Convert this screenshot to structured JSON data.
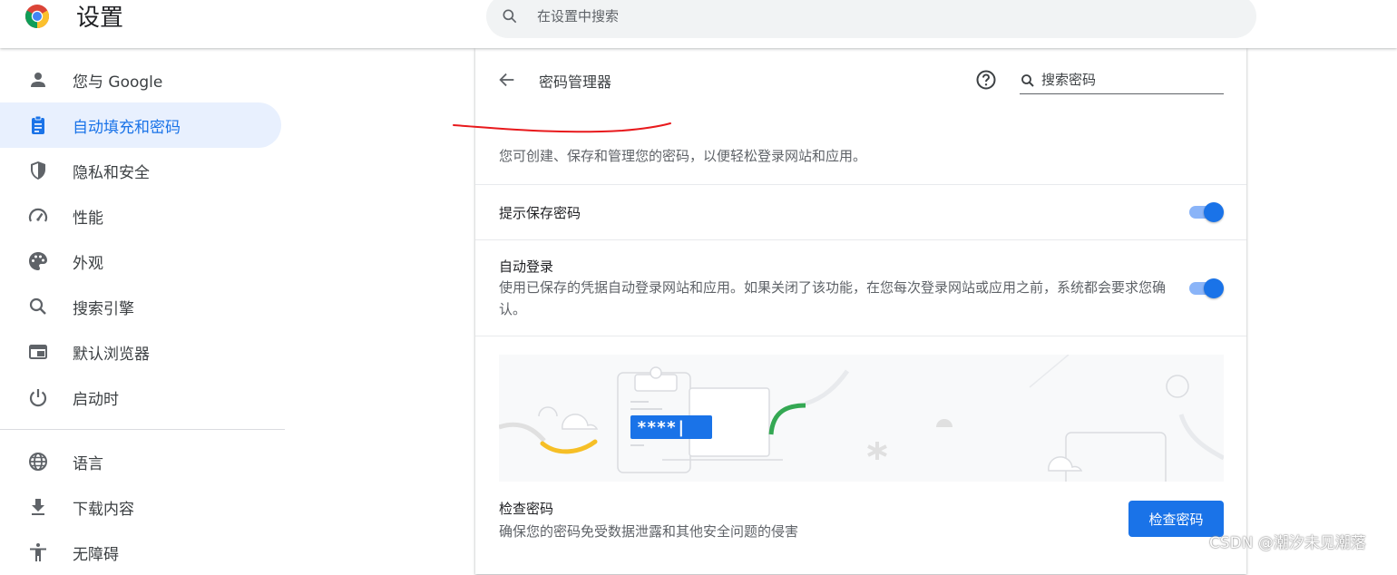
{
  "header": {
    "title": "设置",
    "search_placeholder": "在设置中搜索",
    "logo_icon": "chrome-logo",
    "search_icon": "search-icon"
  },
  "sidebar": {
    "items": [
      {
        "label": "您与 Google",
        "icon": "person-icon",
        "active": false
      },
      {
        "label": "自动填充和密码",
        "icon": "clipboard-icon",
        "active": true
      },
      {
        "label": "隐私和安全",
        "icon": "shield-icon",
        "active": false
      },
      {
        "label": "性能",
        "icon": "speedometer-icon",
        "active": false
      },
      {
        "label": "外观",
        "icon": "palette-icon",
        "active": false
      },
      {
        "label": "搜索引擎",
        "icon": "search-icon",
        "active": false
      },
      {
        "label": "默认浏览器",
        "icon": "browser-window-icon",
        "active": false
      },
      {
        "label": "启动时",
        "icon": "power-icon",
        "active": false
      },
      {
        "label": "语言",
        "icon": "globe-icon",
        "active": false
      },
      {
        "label": "下载内容",
        "icon": "download-icon",
        "active": false
      },
      {
        "label": "无障碍",
        "icon": "accessibility-icon",
        "active": false
      }
    ]
  },
  "main": {
    "title": "密码管理器",
    "search_placeholder": "搜索密码",
    "description": "您可创建、保存和管理您的密码，以便轻松登录网站和应用。",
    "offer_save": {
      "label": "提示保存密码",
      "enabled": true
    },
    "auto_signin": {
      "label": "自动登录",
      "sub": "使用已保存的凭据自动登录网站和应用。如果关闭了该功能，在您每次登录网站或应用之前，系统都会要求您确认。",
      "enabled": true
    },
    "illustration_text": "****|",
    "check": {
      "title": "检查密码",
      "sub": "确保您的密码免受数据泄露和其他安全问题的侵害",
      "button": "检查密码"
    }
  },
  "colors": {
    "accent": "#1a73e8",
    "active_bg": "#e8f0fe",
    "toggle_track": "#8ab4f8",
    "annotation": "#e8191c"
  },
  "watermark": "CSDN @潮汐未见潮落"
}
